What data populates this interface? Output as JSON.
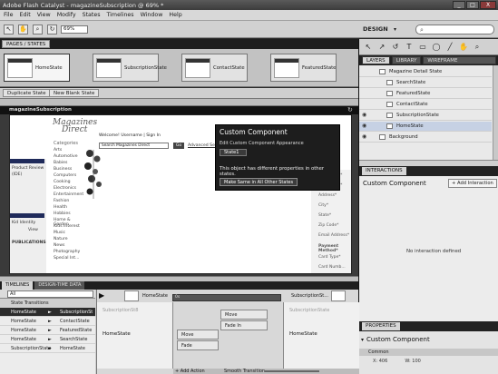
{
  "window": {
    "title": "Adobe Flash Catalyst - magazineSubscription @ 69% *",
    "controls": [
      "_",
      "□",
      "X"
    ]
  },
  "menu": [
    "File",
    "Edit",
    "View",
    "Modify",
    "States",
    "Timelines",
    "Window",
    "Help"
  ],
  "toolbar": {
    "zoom_value": "69%",
    "workspace": "DESIGN"
  },
  "pages_panel": {
    "tab_label": "PAGES / STATES",
    "states": [
      "HomeState",
      "SubscriptionState",
      "ContactState",
      "FeaturedState"
    ],
    "selected_index": 0,
    "duplicate_label": "Duplicate State",
    "new_blank_label": "New Blank State"
  },
  "stage": {
    "artboard_title": "magazineSubscription",
    "site": {
      "logo_line1": "Magazines",
      "logo_line2": "Direct",
      "categories_heading": "Categories",
      "categories": [
        "Arts",
        "Automotive",
        "Babies",
        "Business",
        "Computers",
        "Cooking",
        "Electronics",
        "Entertainment",
        "Fashion",
        "Health",
        "Hobbies",
        "Home & Garden",
        "Kids Interest",
        "Music",
        "Nature",
        "News",
        "Photography",
        "Special Int..."
      ],
      "welcome": "Welcome! Username | Sign In",
      "search_placeholder": "Search Magazines Direct",
      "go_label": "Go",
      "advanced_search": "Advanced Search",
      "left_texts": [
        "Product Review",
        "(IDE)",
        "Kid Identity",
        "View",
        "PUBLICATIONS"
      ],
      "form_labels": [
        "First Name*",
        "Last Name*",
        "Address*",
        "City*",
        "State*",
        "Zip Code*",
        "Email Address*",
        "Payment Method*",
        "Card Type*",
        "Card Numb..."
      ]
    },
    "popup": {
      "title": "Custom Component",
      "subtitle": "Edit Custom Component Appearance",
      "state_value": "State1",
      "message": "This object has different properties in other states.",
      "make_same_label": "Make Same in All Other States"
    }
  },
  "right": {
    "layer_tabs": [
      "LAYERS",
      "LIBRARY",
      "WIREFRAME COMPONENTS"
    ],
    "layers": [
      {
        "name": "Magazine Detail State",
        "indent": 1,
        "visible": false
      },
      {
        "name": "SearchState",
        "indent": 2,
        "visible": false
      },
      {
        "name": "FeaturedState",
        "indent": 2,
        "visible": false
      },
      {
        "name": "ContactState",
        "indent": 2,
        "visible": false
      },
      {
        "name": "SubscriptionState",
        "indent": 2,
        "visible": true
      },
      {
        "name": "HomeState",
        "indent": 2,
        "visible": true
      },
      {
        "name": "Background",
        "indent": 1,
        "visible": true
      }
    ],
    "interactions_tab": "INTERACTIONS",
    "component_name": "Custom Component",
    "add_interaction": "+ Add Interaction",
    "no_interaction": "No interaction defined",
    "properties_tab": "PROPERTIES",
    "properties_name": "Custom Component",
    "properties_section": "Common",
    "prop_x_label": "X:",
    "prop_x": "406",
    "prop_w_label": "W:",
    "prop_w": "100"
  },
  "timelines": {
    "tabs": [
      "TIMELINES",
      "DESIGN-TIME DATA"
    ],
    "filter_value": "All",
    "transitions": [
      {
        "from": "State Transitions",
        "to": "",
        "header": true
      },
      {
        "from": "HomeState",
        "to": "SubscriptionSt"
      },
      {
        "from": "HomeState",
        "to": "ContactState"
      },
      {
        "from": "HomeState",
        "to": "FeaturedState"
      },
      {
        "from": "HomeState",
        "to": "SearchState"
      },
      {
        "from": "SubscriptionState",
        "to": "HomeState"
      }
    ],
    "selected_row": 1,
    "from_state": "HomeState",
    "to_state": "SubscriptionSt...",
    "ruler_start": "0s",
    "from_greyed": "SubscriptionSt8",
    "effects": [
      "Move",
      "Fade In",
      "Move",
      "Fade"
    ],
    "to_greyed": "SubscriptionState",
    "add_action": "+ Add Action",
    "smooth_transition": "Smooth Transition"
  }
}
